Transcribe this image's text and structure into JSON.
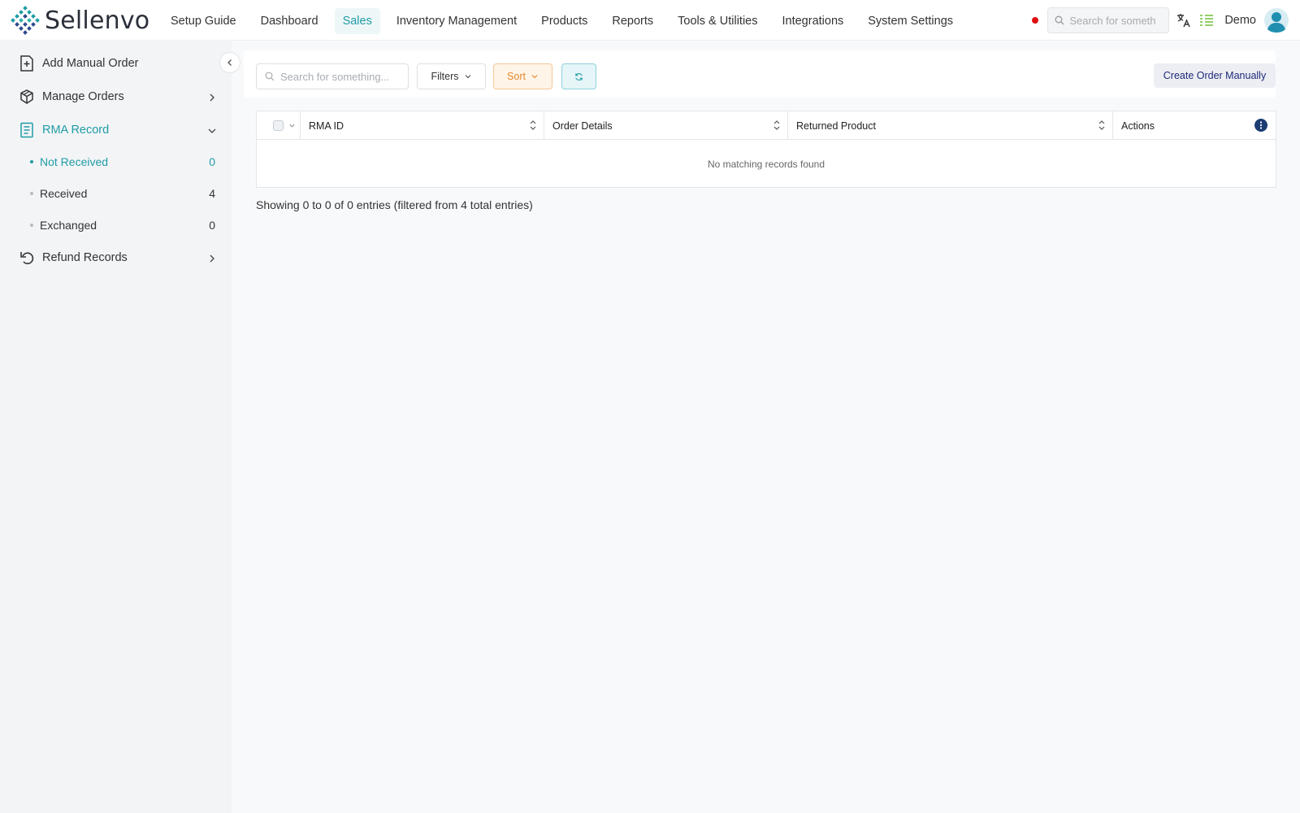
{
  "app": {
    "name": "Sellenvo"
  },
  "nav": {
    "items": [
      {
        "label": "Setup Guide",
        "active": false
      },
      {
        "label": "Dashboard",
        "active": false
      },
      {
        "label": "Sales",
        "active": true
      },
      {
        "label": "Inventory Management",
        "active": false
      },
      {
        "label": "Products",
        "active": false
      },
      {
        "label": "Reports",
        "active": false
      },
      {
        "label": "Tools & Utilities",
        "active": false
      },
      {
        "label": "Integrations",
        "active": false
      },
      {
        "label": "System Settings",
        "active": false
      }
    ]
  },
  "header": {
    "search_placeholder": "Search for someth",
    "username": "Demo",
    "status_color": "#e0100f"
  },
  "sidebar": {
    "items": [
      {
        "label": "Add Manual Order",
        "icon": "file-plus-icon"
      },
      {
        "label": "Manage Orders",
        "icon": "box-icon"
      },
      {
        "label": "RMA Record",
        "icon": "document-icon"
      },
      {
        "label": "Refund Records",
        "icon": "undo-icon"
      }
    ],
    "rma_sub": [
      {
        "label": "Not Received",
        "count": "0",
        "active": true
      },
      {
        "label": "Received",
        "count": "4",
        "active": false
      },
      {
        "label": "Exchanged",
        "count": "0",
        "active": false
      }
    ]
  },
  "toolbar": {
    "search_placeholder": "Search for something...",
    "filters_label": "Filters",
    "sort_label": "Sort",
    "create_label": "Create Order Manually"
  },
  "table": {
    "columns": [
      "RMA ID",
      "Order Details",
      "Returned Product",
      "Actions"
    ],
    "empty_message": "No matching records found"
  },
  "footer": {
    "info": "Showing 0 to 0 of 0 entries (filtered from 4 total entries)"
  },
  "colors": {
    "accent": "#1f9ca6",
    "sort": "#e48a2c",
    "create_text": "#1e2a78"
  }
}
